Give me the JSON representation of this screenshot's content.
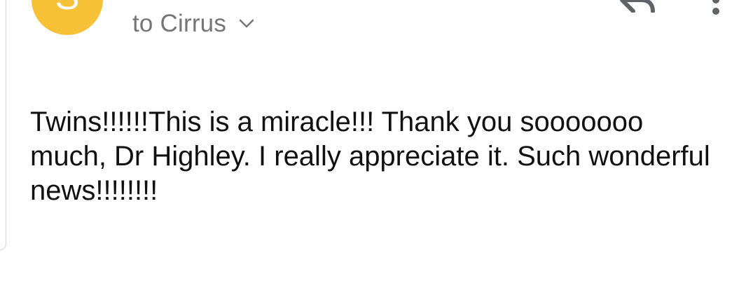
{
  "sender": {
    "avatar_initial": "S",
    "avatar_color": "#f6c136"
  },
  "recipient": {
    "label": "to Cirrus"
  },
  "icons": {
    "expand": "chevron-down-icon",
    "reply": "reply-icon",
    "more": "more-vert-icon"
  },
  "message": {
    "body": "Twins!!!!!!This is a miracle!!! Thank you sooooooo much, Dr Highley. I really appreciate it. Such wonderful news!!!!!!!!"
  }
}
